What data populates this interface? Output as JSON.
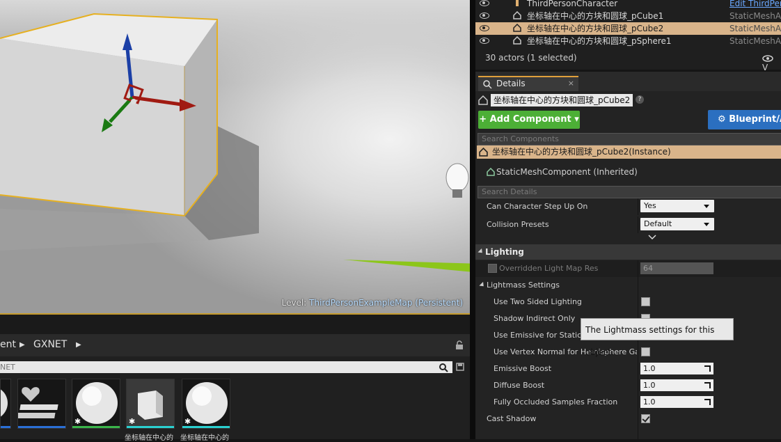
{
  "outliner": {
    "rows": [
      {
        "label": "ThirdPersonCharacter",
        "type": "Edit ThirdPer",
        "selected": false
      },
      {
        "label": "坐标轴在中心的方块和圆球_pCube1",
        "type": "StaticMeshAc",
        "selected": false
      },
      {
        "label": "坐标轴在中心的方块和圆球_pCube2",
        "type": "StaticMeshAc",
        "selected": true
      },
      {
        "label": "坐标轴在中心的方块和圆球_pSphere1",
        "type": "StaticMeshAc",
        "selected": false
      }
    ],
    "actors_count": "30 actors (1 selected)",
    "view_options": "V"
  },
  "viewport": {
    "level_prefix": "Level:",
    "level_name": "ThirdPersonExampleMap (Persistent)"
  },
  "details": {
    "tab_label": "Details",
    "tab_close": "×",
    "component_name": "坐标轴在中心的方块和圆球_pCube2",
    "help": "?",
    "add_component": "+ Add Component ▾",
    "blueprint": "Blueprint/A",
    "search_components_placeholder": "Search Components",
    "instance_row": "坐标轴在中心的方块和圆球_pCube2(Instance)",
    "inherited_row": "StaticMeshComponent (Inherited)",
    "search_details_placeholder": "Search Details",
    "can_step_up": {
      "label": "Can Character Step Up On",
      "value": "Yes"
    },
    "collision_presets": {
      "label": "Collision Presets",
      "value": "Default"
    },
    "lighting_category": "Lighting",
    "overridden_lightmap": {
      "label": "Overridden Light Map Res",
      "value": "64"
    },
    "lightmass_settings": "Lightmass Settings",
    "two_sided": "Use Two Sided Lighting",
    "shadow_indirect": "Shadow Indirect Only",
    "emissive_static": "Use Emissive for Static Lighting",
    "vertex_normal": "Use Vertex Normal for Hemisphere Gathe",
    "emissive_boost": {
      "label": "Emissive Boost",
      "value": "1.0"
    },
    "diffuse_boost": {
      "label": "Diffuse Boost",
      "value": "1.0"
    },
    "occluded_samples": {
      "label": "Fully Occluded Samples Fraction",
      "value": "1.0"
    },
    "cast_shadow": "Cast Shadow",
    "tooltip": "The Lightmass settings for this object."
  },
  "content_browser": {
    "path": [
      "ent",
      "GXNET"
    ],
    "search_value": "NET",
    "captions": [
      "坐标轴在中心的",
      "坐标轴在中心的"
    ]
  }
}
